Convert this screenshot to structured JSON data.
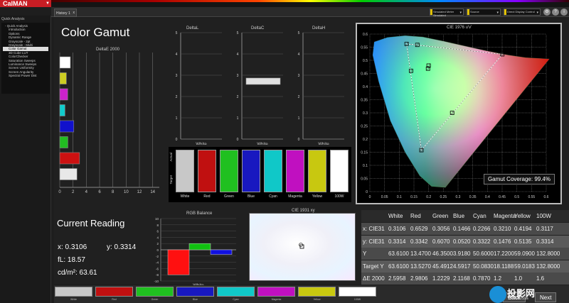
{
  "app": {
    "name": "CalMAN"
  },
  "sidebar": {
    "header": "Quick Analysis",
    "items": [
      {
        "label": "Quick Analysis",
        "group": true
      },
      {
        "label": "Introduction"
      },
      {
        "label": "Options"
      },
      {
        "label": "Dynamic Range"
      },
      {
        "label": "Grayscale - 2pt"
      },
      {
        "label": "Grayscale - Multi"
      },
      {
        "label": "Color Gamut",
        "selected": true
      },
      {
        "label": "3D Cube LUT"
      },
      {
        "label": "ColorChecker"
      },
      {
        "label": "Saturation Sweeps"
      },
      {
        "label": "Luminance Sweeps"
      },
      {
        "label": "Screen Uniformity"
      },
      {
        "label": "Screen Angularity"
      },
      {
        "label": "Spectral Power Dist"
      }
    ]
  },
  "tabs": [
    {
      "label": "History 1",
      "close": "x"
    }
  ],
  "toolbar": {
    "dropdowns": [
      {
        "label": "Simulated Meter Simulated"
      },
      {
        "label": "Source"
      },
      {
        "label": "Direct Display Control"
      }
    ]
  },
  "page": {
    "title": "Color Gamut"
  },
  "deltae": {
    "title": "DeltaE 2000",
    "ticks": [
      "0",
      "2",
      "4",
      "6",
      "8",
      "10",
      "12",
      "14"
    ],
    "bars": [
      {
        "name": "White",
        "value": 2.5958,
        "color": "#e8e8e8"
      },
      {
        "name": "Red",
        "value": 2.9806,
        "color": "#cc1111"
      },
      {
        "name": "Green",
        "value": 1.2229,
        "color": "#22bb22"
      },
      {
        "name": "Blue",
        "value": 2.1168,
        "color": "#1111cc"
      },
      {
        "name": "Cyan",
        "value": 0.787,
        "color": "#11cccc"
      },
      {
        "name": "Magenta",
        "value": 1.2,
        "color": "#cc22cc"
      },
      {
        "name": "Yellow",
        "value": 1.0,
        "color": "#cccc22"
      },
      {
        "name": "100W",
        "value": 1.6,
        "color": "#ffffff"
      }
    ]
  },
  "delta_panels": [
    {
      "title": "DeltaL",
      "xlabel": "White"
    },
    {
      "title": "DeltaC",
      "xlabel": "White"
    },
    {
      "title": "DeltaH",
      "xlabel": "White"
    }
  ],
  "delta_ticks": [
    "5",
    "4",
    "3",
    "2",
    "1",
    "0"
  ],
  "swatches": {
    "row_labels": [
      "Actual",
      "Target"
    ],
    "items": [
      {
        "label": "White",
        "color": "#c8c8c8"
      },
      {
        "label": "Red",
        "color": "#c01010"
      },
      {
        "label": "Green",
        "color": "#20c020"
      },
      {
        "label": "Blue",
        "color": "#1818c0"
      },
      {
        "label": "Cyan",
        "color": "#10c8c8"
      },
      {
        "label": "Magenta",
        "color": "#c010c0"
      },
      {
        "label": "Yellow",
        "color": "#c8c810"
      },
      {
        "label": "100W",
        "color": "#ffffff"
      }
    ]
  },
  "cie1976": {
    "title": "CIE 1976 u'v'",
    "coverage_label": "Gamut Coverage:",
    "coverage": "99.4%",
    "x_ticks": [
      "0",
      "0.05",
      "0.1",
      "0.15",
      "0.2",
      "0.25",
      "0.3",
      "0.35",
      "0.4",
      "0.45",
      "0.5",
      "0.55",
      "0.6"
    ],
    "y_ticks": [
      "0.6",
      "0.55",
      "0.5",
      "0.45",
      "0.4",
      "0.35",
      "0.3",
      "0.25",
      "0.2",
      "0.15",
      "0.1",
      "0.05",
      "0"
    ]
  },
  "reading": {
    "title": "Current Reading",
    "x": "x: 0.3106",
    "y": "y: 0.3314",
    "fl": "fL: 18.57",
    "cdm": "cd/m²: 63.61"
  },
  "rgb_balance": {
    "title": "RGB Balance",
    "xlabel": "White",
    "ticks": [
      "10",
      "8",
      "6",
      "4",
      "2",
      "0",
      "-2",
      "-4",
      "-6",
      "-8",
      "-10"
    ],
    "values": [
      {
        "name": "R",
        "value": -8,
        "color": "#ff1010"
      },
      {
        "name": "G",
        "value": 2,
        "color": "#10c010"
      },
      {
        "name": "B",
        "value": -1.5,
        "color": "#1010e0"
      }
    ]
  },
  "cie1931": {
    "title": "CIE 1931 xy"
  },
  "table": {
    "headers": [
      "",
      "White",
      "Red",
      "Green",
      "Blue",
      "Cyan",
      "Magenta",
      "Yellow",
      "100W"
    ],
    "rows": [
      [
        "x: CIE31",
        "0.3106",
        "0.6529",
        "0.3056",
        "0.1466",
        "0.2266",
        "0.3210",
        "0.4194",
        "0.3117"
      ],
      [
        "y: CIE31",
        "0.3314",
        "0.3342",
        "0.6070",
        "0.0520",
        "0.3322",
        "0.1476",
        "0.5135",
        "0.3314"
      ],
      [
        "Y",
        "63.6100",
        "13.4700",
        "46.3500",
        "3.9180",
        "50.6000",
        "17.2200",
        "59.0900",
        "132.8000"
      ],
      [
        "Target Y",
        "63.6100",
        "13.5270",
        "45.4912",
        "4.5917",
        "50.0830",
        "18.1188",
        "59.0183",
        "132.8000"
      ],
      [
        "ΔE 2000",
        "2.5958",
        "2.9806",
        "1.2229",
        "2.1168",
        "0.7870",
        "1.2",
        "1.0",
        "1.6"
      ]
    ]
  },
  "bottom": {
    "swatches": [
      {
        "label": "White",
        "color": "#c8c8c8"
      },
      {
        "label": "Red",
        "color": "#c01010"
      },
      {
        "label": "Green",
        "color": "#20c020"
      },
      {
        "label": "Blue",
        "color": "#1818c0"
      },
      {
        "label": "Cyan",
        "color": "#10c8c8"
      },
      {
        "label": "Magenta",
        "color": "#c010c0"
      },
      {
        "label": "Yellow",
        "color": "#c8c810"
      },
      {
        "label": "100W",
        "color": "#ffffff"
      }
    ],
    "back": "Back",
    "next": "Next"
  },
  "watermark": {
    "text": "投影网",
    "sub": "TOUYING.COM"
  }
}
